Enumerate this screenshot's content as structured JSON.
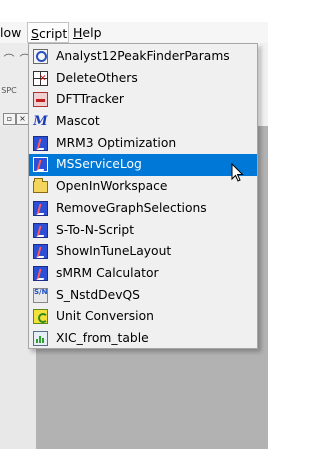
{
  "menubar": {
    "window_label": "low",
    "script_label": "Script",
    "script_accel": "S",
    "script_rest": "cript",
    "help_label": "Help",
    "help_accel": "H",
    "help_rest": "elp"
  },
  "toolbar": {
    "label_spc": "SPC",
    "close_glyph": "×",
    "restore_glyph": "▫"
  },
  "script_menu": {
    "items": [
      {
        "label": "Analyst12PeakFinderParams",
        "icon": "search-icon"
      },
      {
        "label": "DeleteOthers",
        "icon": "grid-delete-icon"
      },
      {
        "label": "DFTTracker",
        "icon": "dft-icon"
      },
      {
        "label": "Mascot",
        "icon": "mascot-icon"
      },
      {
        "label": "MRM3 Optimization",
        "icon": "script-icon"
      },
      {
        "label": "MSServiceLog",
        "icon": "script-icon",
        "selected": true
      },
      {
        "label": "OpenInWorkspace",
        "icon": "folder-icon"
      },
      {
        "label": "RemoveGraphSelections",
        "icon": "script-icon"
      },
      {
        "label": "S-To-N-Script",
        "icon": "script-icon"
      },
      {
        "label": "ShowInTuneLayout",
        "icon": "script-icon"
      },
      {
        "label": "sMRM Calculator",
        "icon": "script-icon"
      },
      {
        "label": "S_NstdDevQS",
        "icon": "sn-icon"
      },
      {
        "label": "Unit Conversion",
        "icon": "unit-conversion-icon"
      },
      {
        "label": "XIC_from_table",
        "icon": "xic-icon"
      }
    ],
    "selected_color": "#0078d7"
  }
}
